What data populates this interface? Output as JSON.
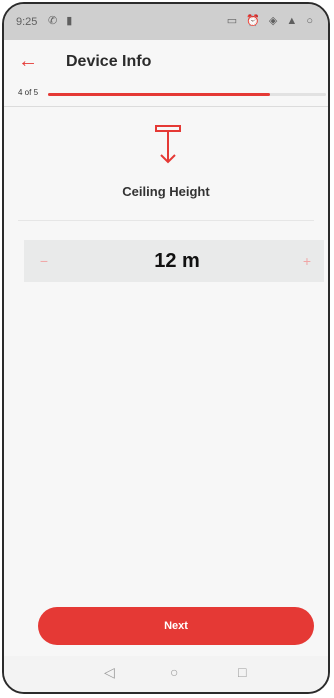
{
  "status_bar": {
    "time": "9:25",
    "left_icons": "✆ ▮",
    "right_icons": "▭ ⏰ ◈ ▲ ○"
  },
  "header": {
    "back_icon": "arrow-left-icon",
    "title": "Device Info"
  },
  "progress": {
    "step_label": "4 of 5",
    "fraction": 0.8
  },
  "field": {
    "icon": "ceiling-height-icon",
    "label": "Ceiling Height",
    "value": "12 m",
    "decrement": "−",
    "increment": "+"
  },
  "footer": {
    "next_label": "Next"
  },
  "nav_bar": {
    "back": "◁",
    "home": "○",
    "recent": "□"
  },
  "colors": {
    "accent": "#e53935",
    "accent_light": "#f0a6a6"
  }
}
